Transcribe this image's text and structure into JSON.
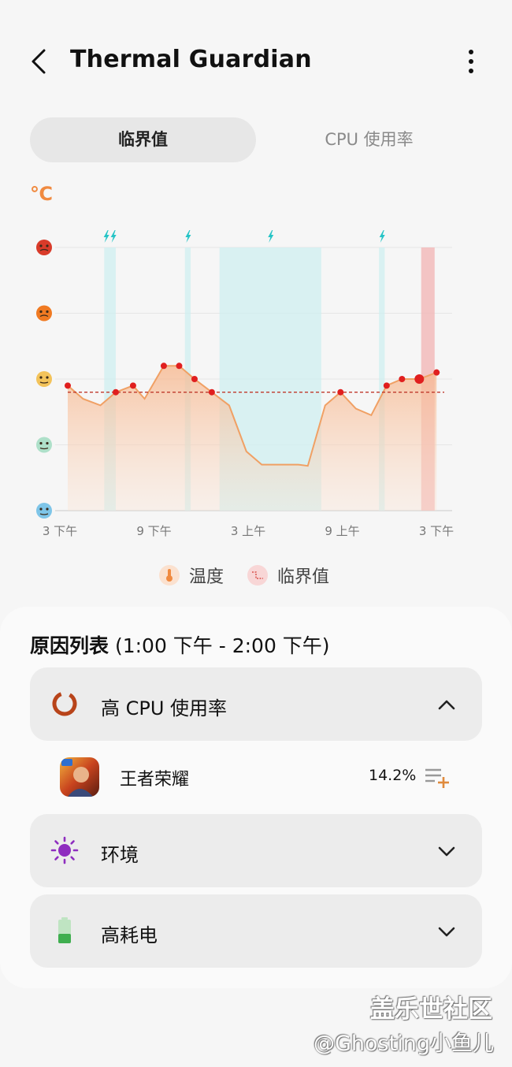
{
  "header": {
    "title": "Thermal Guardian"
  },
  "tabs": [
    {
      "label": "临界值",
      "active": true
    },
    {
      "label": "CPU 使用率",
      "active": false
    }
  ],
  "chart_data": {
    "type": "area",
    "unit": "℃",
    "x_ticks": [
      "3 下午",
      "9 下午",
      "3 上午",
      "9 上午",
      "3 下午"
    ],
    "y_levels": [
      "very-hot-face-icon",
      "hot-face-icon",
      "neutral-face-icon",
      "calm-face-icon",
      "cool-face-icon"
    ],
    "y_range": [
      0,
      4
    ],
    "threshold_level": 1.8,
    "temperature": [
      {
        "x": 0.0,
        "y": 1.9,
        "dot": true
      },
      {
        "x": 0.4,
        "y": 1.7
      },
      {
        "x": 0.85,
        "y": 1.6
      },
      {
        "x": 1.25,
        "y": 1.8,
        "dot": true
      },
      {
        "x": 1.7,
        "y": 1.9,
        "dot": true
      },
      {
        "x": 2.0,
        "y": 1.7
      },
      {
        "x": 2.5,
        "y": 2.2,
        "dot": true
      },
      {
        "x": 2.9,
        "y": 2.2,
        "dot": true
      },
      {
        "x": 3.3,
        "y": 2.0,
        "dot": true
      },
      {
        "x": 3.75,
        "y": 1.8,
        "dot": true
      },
      {
        "x": 4.2,
        "y": 1.6
      },
      {
        "x": 4.65,
        "y": 0.9
      },
      {
        "x": 5.05,
        "y": 0.7
      },
      {
        "x": 5.5,
        "y": 0.7
      },
      {
        "x": 6.0,
        "y": 0.7
      },
      {
        "x": 6.25,
        "y": 0.68
      },
      {
        "x": 6.7,
        "y": 1.6
      },
      {
        "x": 7.1,
        "y": 1.8,
        "dot": true
      },
      {
        "x": 7.5,
        "y": 1.55
      },
      {
        "x": 7.9,
        "y": 1.45
      },
      {
        "x": 8.3,
        "y": 1.9,
        "dot": true
      },
      {
        "x": 8.7,
        "y": 2.0,
        "dot": true
      },
      {
        "x": 9.15,
        "y": 2.0,
        "dot": true,
        "big": true
      },
      {
        "x": 9.6,
        "y": 2.1,
        "dot": true
      }
    ],
    "charging_bands": [
      {
        "from": 0.95,
        "to": 1.25,
        "icon": "double"
      },
      {
        "from": 3.05,
        "to": 3.2,
        "icon": "single"
      },
      {
        "from": 3.95,
        "to": 6.6,
        "icon": "single"
      },
      {
        "from": 8.1,
        "to": 8.25,
        "icon": "single"
      }
    ],
    "critical_band": {
      "from": 9.2,
      "to": 9.55
    },
    "x_max": 9.8,
    "legend": [
      {
        "name": "温度",
        "color": "#f4a26b"
      },
      {
        "name": "临界值",
        "color": "#e57373"
      }
    ]
  },
  "reasons": {
    "title_main": "原因列表",
    "title_range": "(1:00 下午 - 2:00 下午)",
    "items": [
      {
        "label": "高 CPU 使用率",
        "icon": "cpu-ring-icon",
        "expanded": true,
        "apps": [
          {
            "name": "王者荣耀",
            "percent": "14.2%"
          }
        ]
      },
      {
        "label": "环境",
        "icon": "sun-icon",
        "expanded": false
      },
      {
        "label": "高耗电",
        "icon": "battery-icon",
        "expanded": false
      }
    ]
  },
  "watermark": {
    "line1": "盖乐世社区",
    "line2": "@Ghosting小鱼儿"
  }
}
